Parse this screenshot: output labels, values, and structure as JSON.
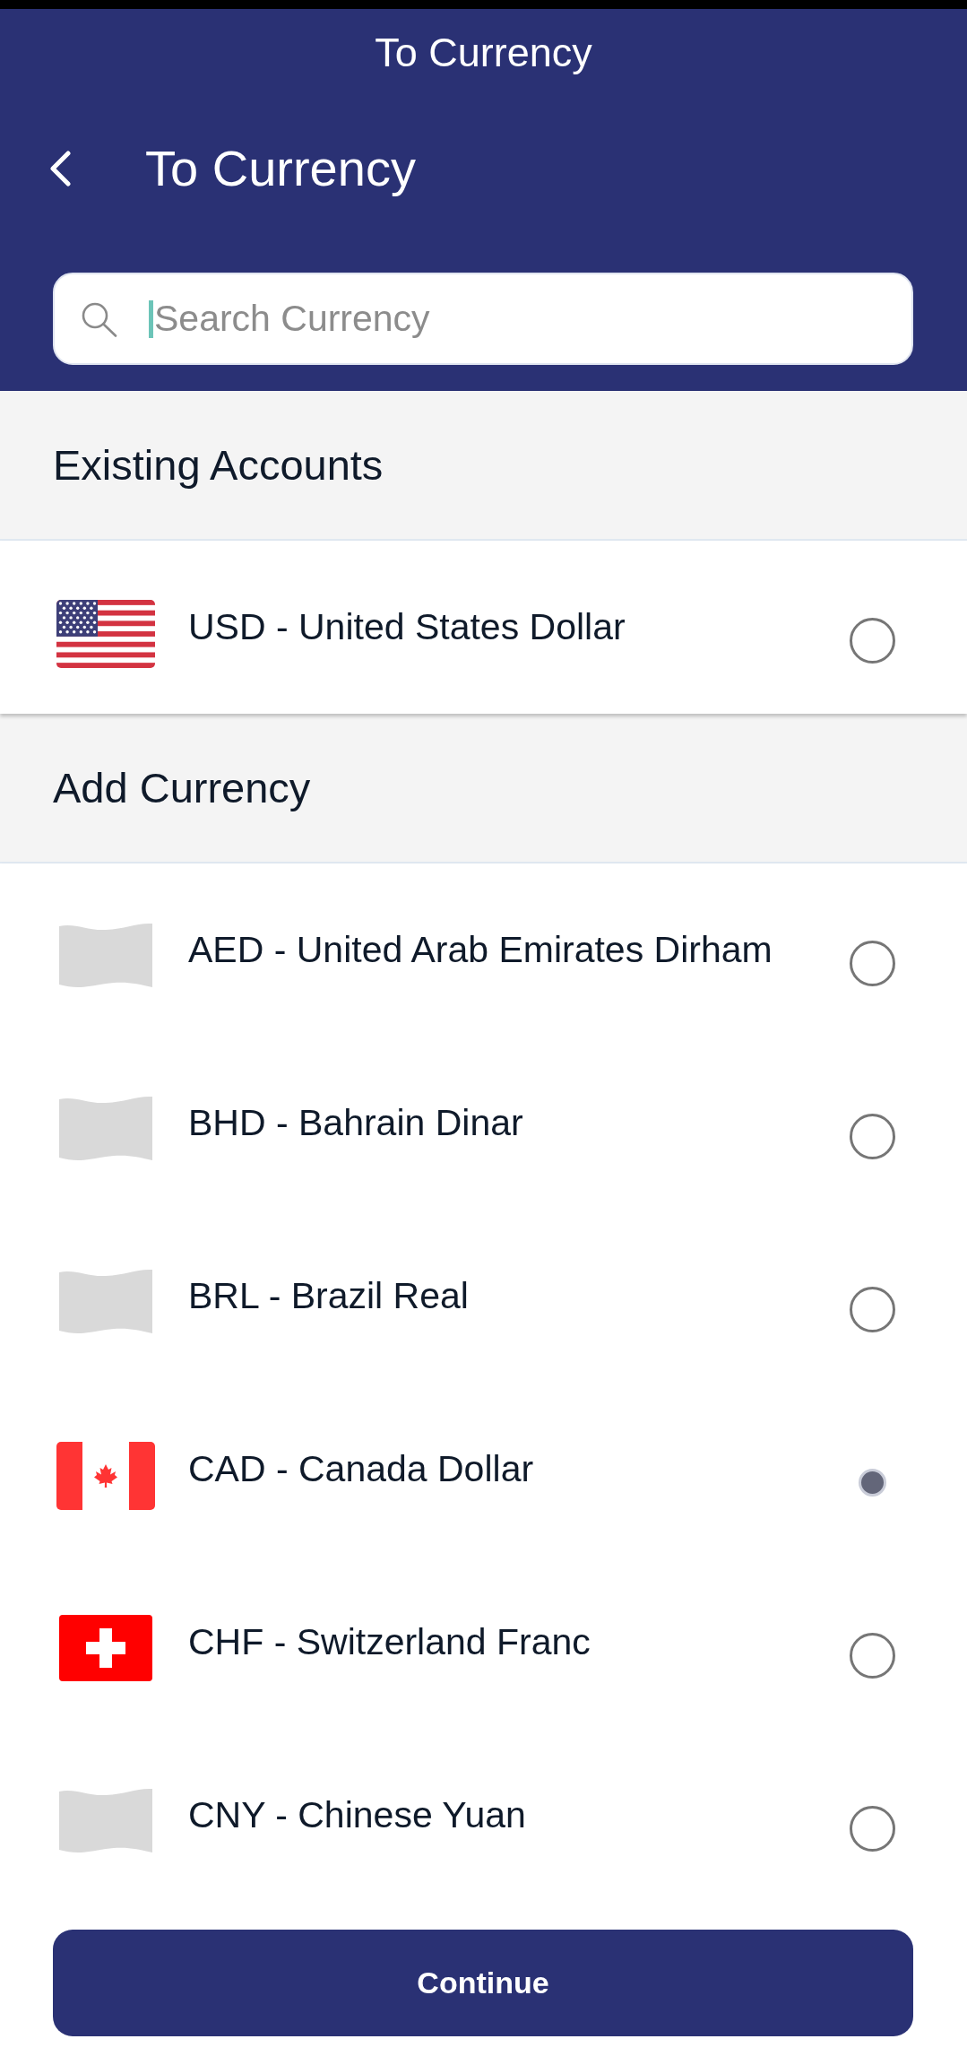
{
  "window": {
    "title": "To Currency"
  },
  "app_bar": {
    "title": "To Currency"
  },
  "search": {
    "placeholder": "Search Currency"
  },
  "sections": [
    {
      "title": "Existing Accounts",
      "items": [
        {
          "label": "USD - United States Dollar",
          "kind": "usa",
          "selected": false
        }
      ]
    },
    {
      "title": "Add Currency",
      "items": [
        {
          "label": "AED - United Arab Emirates Dirham",
          "kind": "blank",
          "selected": false
        },
        {
          "label": "BHD - Bahrain Dinar",
          "kind": "blank",
          "selected": false
        },
        {
          "label": "BRL - Brazil Real",
          "kind": "blank",
          "selected": false
        },
        {
          "label": "CAD - Canada Dollar",
          "kind": "canada",
          "selected": true
        },
        {
          "label": "CHF - Switzerland Franc",
          "kind": "switzerland",
          "selected": false
        },
        {
          "label": "CNY - Chinese Yuan",
          "kind": "blank",
          "selected": false
        }
      ]
    }
  ],
  "continue_button": {
    "label": "Continue"
  }
}
